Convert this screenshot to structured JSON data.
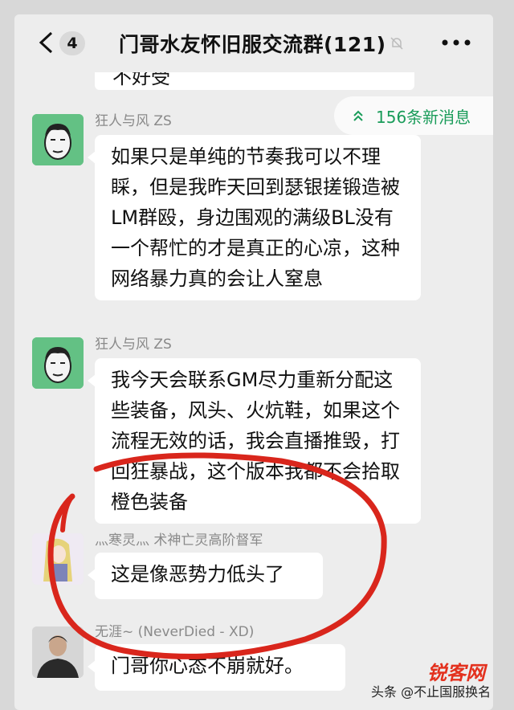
{
  "header": {
    "back_badge": "4",
    "title": "门哥水友怀旧服交流群(121)"
  },
  "new_messages": "156条新消息",
  "partial_bubble_text": "不好受",
  "messages": [
    {
      "sender": "狂人与风 ZS",
      "text": "如果只是单纯的节奏我可以不理睬，但是我昨天回到瑟银搓锻造被LM群殴，身边围观的满级BL没有一个帮忙的才是真正的心凉，这种网络暴力真的会让人窒息"
    },
    {
      "sender": "狂人与风 ZS",
      "text": "我今天会联系GM尽力重新分配这些装备，风头、火炕鞋，如果这个流程无效的话，我会直播推毁，打回狂暴战，这个版本我都不会拾取橙色装备"
    },
    {
      "sender": "灬寒灵灬 术神亡灵高阶督军",
      "text": "这是像恶势力低头了"
    },
    {
      "sender": "无涯~ (NeverDied - XD)",
      "text": "门哥你心态不崩就好。"
    }
  ],
  "watermark": {
    "site": "锐客网",
    "caption": "头条 @不止国服换名"
  },
  "colors": {
    "accent_green": "#1a9c5a",
    "annotation_red": "#d9261c",
    "background": "#ededed"
  }
}
